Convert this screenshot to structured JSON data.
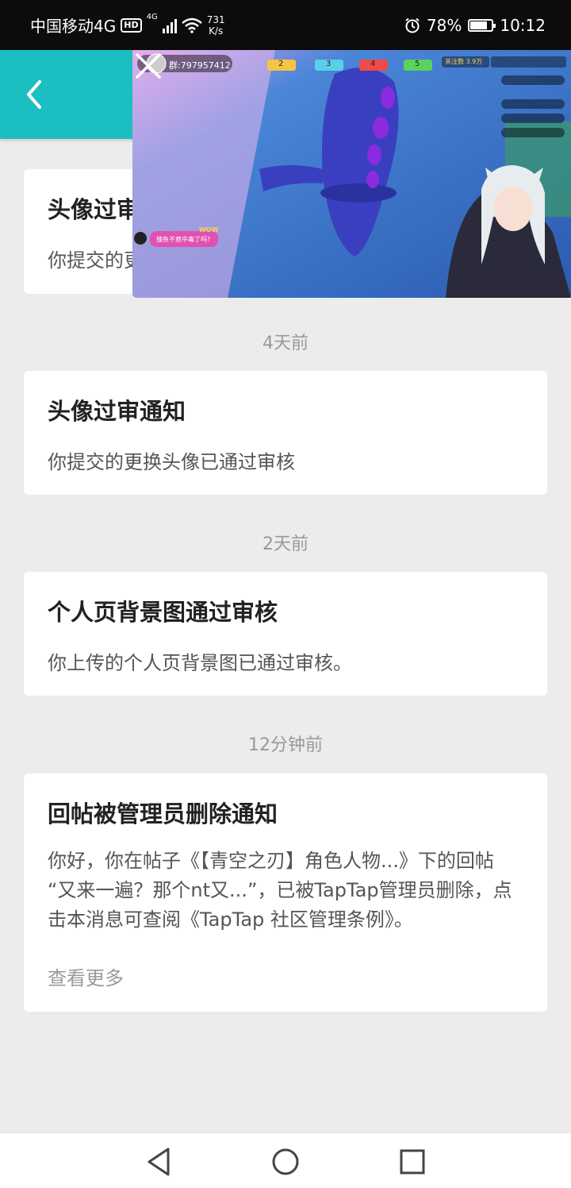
{
  "status_bar": {
    "carrier": "中国移动4G",
    "hd_badge": "HD",
    "network_type": "4G",
    "speed_value": "731",
    "speed_unit": "K/s",
    "battery": "78%",
    "battery_level": 0.78,
    "time": "10:12"
  },
  "header": {
    "back_icon": "chevron-left-icon",
    "color": "#1bbfc2"
  },
  "notifications": [
    {
      "title": "头像过审通知",
      "body": "你提交的更换头像已通过审核"
    },
    {
      "time": "4天前",
      "title": "头像过审通知",
      "body": "你提交的更换头像已通过审核"
    },
    {
      "time": "2天前",
      "title": "个人页背景图通过审核",
      "body": "你上传的个人页背景图已通过审核。"
    },
    {
      "time": "12分钟前",
      "title": "回帖被管理员删除通知",
      "body": "你好，你在帖子《【青空之刃】角色人物...》下的回帖 “又来一遍？那个nt又...”，已被TapTap管理员删除，点击本消息可查阅《TapTap 社区管理条例》。",
      "more": "查看更多"
    }
  ],
  "floating_video": {
    "group_label": "群:797957412",
    "chat_bubble": "撞鱼不竟中毒了吗?",
    "wow": "WOW",
    "badges": [
      "2",
      "3",
      "4",
      "5"
    ],
    "follow": "关注数 3.9万",
    "close_icon": "close-icon"
  },
  "nav_bar": {
    "back": "triangle-back-icon",
    "home": "circle-home-icon",
    "recents": "square-recents-icon"
  }
}
